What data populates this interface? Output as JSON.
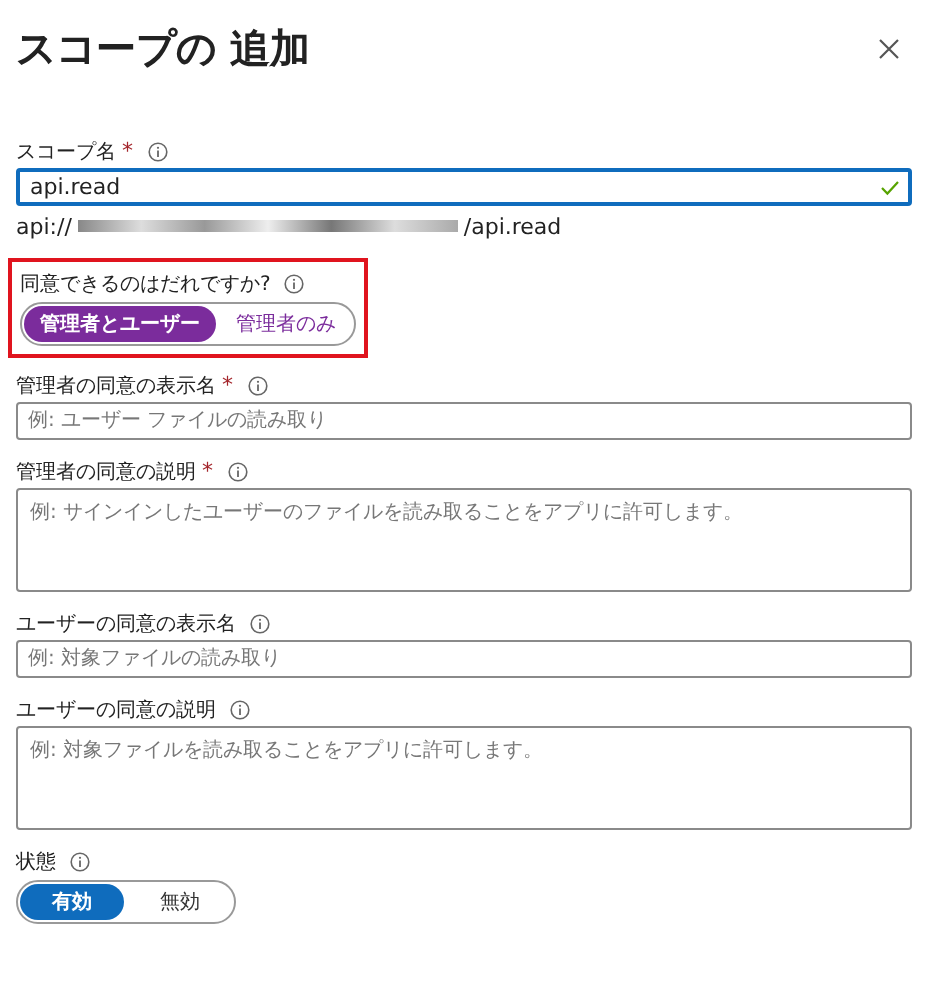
{
  "title": "スコープの 追加",
  "fields": [
    {
      "kind": "text",
      "label": "スコープ名",
      "required_mark": "*",
      "value": "api.read",
      "valid": true,
      "focused": true,
      "uri_prefix": "api://",
      "uri_suffix": "/api.read"
    },
    {
      "kind": "toggle",
      "label": "同意できるのはだれですか?",
      "highlighted": true,
      "color": "#7b2c9c",
      "options": [
        {
          "label": "管理者とユーザー",
          "selected": true
        },
        {
          "label": "管理者のみ",
          "selected": false
        }
      ]
    },
    {
      "kind": "text",
      "label": "管理者の同意の表示名",
      "required_mark": "*",
      "placeholder": "例: ユーザー ファイルの読み取り"
    },
    {
      "kind": "textarea",
      "label": "管理者の同意の説明",
      "required_mark": "*",
      "placeholder": "例: サインインしたユーザーのファイルを読み取ることをアプリに許可します。"
    },
    {
      "kind": "text",
      "label": "ユーザーの同意の表示名",
      "placeholder": "例: 対象ファイルの読み取り"
    },
    {
      "kind": "textarea",
      "label": "ユーザーの同意の説明",
      "placeholder": "例: 対象ファイルを読み取ることをアプリに許可します。"
    },
    {
      "kind": "toggle",
      "label": "状態",
      "color": "#0f6cbd",
      "options": [
        {
          "label": "有効",
          "selected": true
        },
        {
          "label": "無効",
          "selected": false
        }
      ]
    }
  ]
}
